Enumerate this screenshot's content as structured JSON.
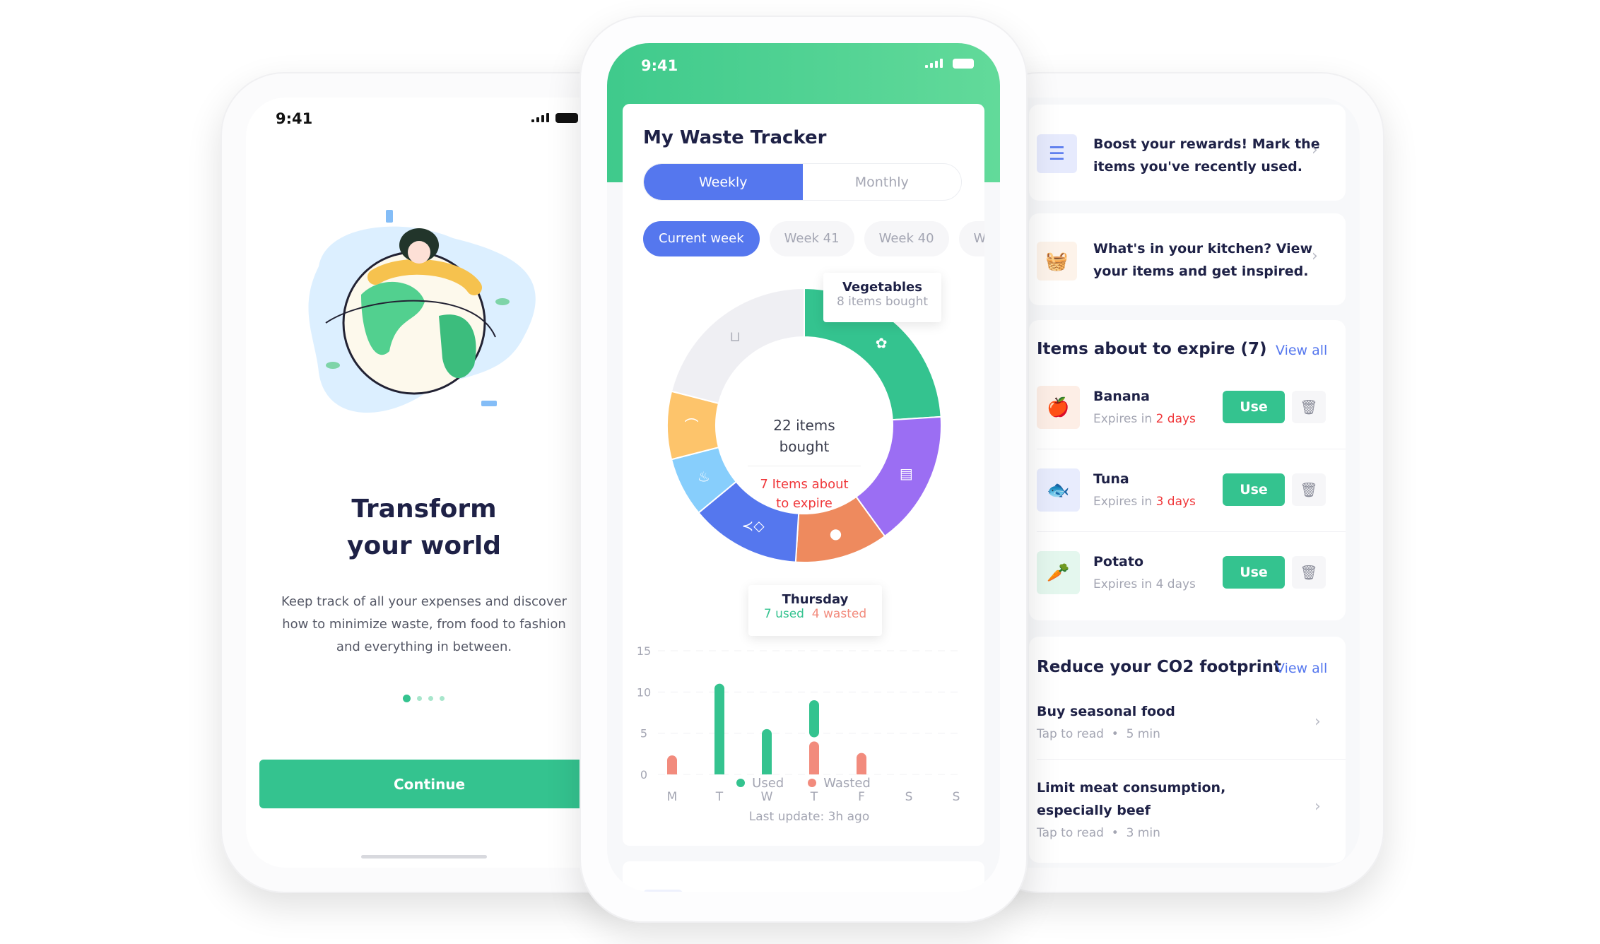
{
  "colors": {
    "green": "#34c38f",
    "blue": "#5577ee",
    "red": "#f0383b",
    "wasted": "#f28b7d",
    "navy": "#1e2146"
  },
  "onboarding": {
    "time": "9:41",
    "title_line1": "Transform",
    "title_line2": "your world",
    "body_line1": "Keep track of all your expenses and discover",
    "body_line2": "how to minimize waste, from food to fashion",
    "body_line3": "and everything in between.",
    "page_indicator": {
      "current": 1,
      "total": 4
    },
    "continue_label": "Continue"
  },
  "tracker": {
    "time": "9:41",
    "title": "My Waste Tracker",
    "segments": [
      {
        "label": "Weekly",
        "active": true
      },
      {
        "label": "Monthly",
        "active": false
      }
    ],
    "weeks": [
      {
        "label": "Current week",
        "active": true
      },
      {
        "label": "Week 41"
      },
      {
        "label": "Week 40"
      },
      {
        "label": "We"
      }
    ],
    "donut_center": {
      "line1": "22 items",
      "line2": "bought",
      "expire_line1": "7 Items about",
      "expire_line2": "to expire"
    },
    "donut_tooltip": {
      "title": "Vegetables",
      "subtitle": "8 items bought"
    },
    "bar_tooltip": {
      "title": "Thursday",
      "used": "7 used",
      "wasted": "4 wasted"
    },
    "last_update": "Last update: 3h ago"
  },
  "chart_data": [
    {
      "type": "pie",
      "style": "donut",
      "total_label": "22 items bought",
      "slices": [
        {
          "category": "vegetables",
          "icon": "vegetables-icon",
          "share_pct": 24,
          "color": "#34c38f"
        },
        {
          "category": "dairy",
          "icon": "milk-cheese-icon",
          "share_pct": 16,
          "color": "#9b6ef3"
        },
        {
          "category": "fruit",
          "icon": "apple-icon",
          "share_pct": 11,
          "color": "#ee8a5e"
        },
        {
          "category": "fish",
          "icon": "fish-icon",
          "share_pct": 13,
          "color": "#5577ee"
        },
        {
          "category": "meat",
          "icon": "chicken-leg-icon",
          "share_pct": 7,
          "color": "#87cefc"
        },
        {
          "category": "bread",
          "icon": "bread-icon",
          "share_pct": 8,
          "color": "#fdc46b"
        },
        {
          "category": "other",
          "icon": "shopping-bag-icon",
          "share_pct": 21,
          "color": "#efeff3"
        }
      ]
    },
    {
      "type": "bar",
      "categories": [
        "M",
        "T",
        "W",
        "T",
        "F",
        "S",
        "S"
      ],
      "ylim": [
        0,
        15
      ],
      "yticks": [
        "0",
        "5",
        "10",
        "15"
      ],
      "grid": true,
      "legend": "bottom",
      "series": [
        {
          "name": "Used",
          "color": "#34c38f",
          "values": [
            0,
            11,
            5.5,
            7,
            0,
            0,
            0
          ]
        },
        {
          "name": "Wasted",
          "color": "#f28b7d",
          "values": [
            2.3,
            0,
            0,
            4,
            2.6,
            0,
            0
          ]
        }
      ]
    }
  ],
  "dashboard": {
    "promos": [
      {
        "text1": "Boost your rewards! Mark the",
        "text2": "items you've recently used.",
        "icon": "list-icon"
      },
      {
        "text1": "What's in your kitchen? View",
        "text2": "your items and get inspired.",
        "icon": "basket-icon"
      }
    ],
    "expire": {
      "title": "Items about to expire (7)",
      "view_all": "View all",
      "items": [
        {
          "name": "Banana",
          "prefix": "Expires in",
          "days": "2 days",
          "urgent": true,
          "icon": "apple-icon",
          "use": "Use"
        },
        {
          "name": "Tuna",
          "prefix": "Expires in",
          "days": "3 days",
          "urgent": true,
          "icon": "fish-icon",
          "use": "Use"
        },
        {
          "name": "Potato",
          "prefix": "Expires in",
          "days": "4 days",
          "urgent": false,
          "icon": "vegetables-icon",
          "use": "Use"
        }
      ]
    },
    "co2": {
      "title": "Reduce your CO2 footprint",
      "view_all": "View all",
      "articles": [
        {
          "title1": "Buy seasonal food",
          "title2": "",
          "meta": "Tap to read  •  5 min"
        },
        {
          "title1": "Limit meat consumption,",
          "title2": "especially beef",
          "meta": "Tap to read  •  3 min"
        }
      ]
    }
  }
}
